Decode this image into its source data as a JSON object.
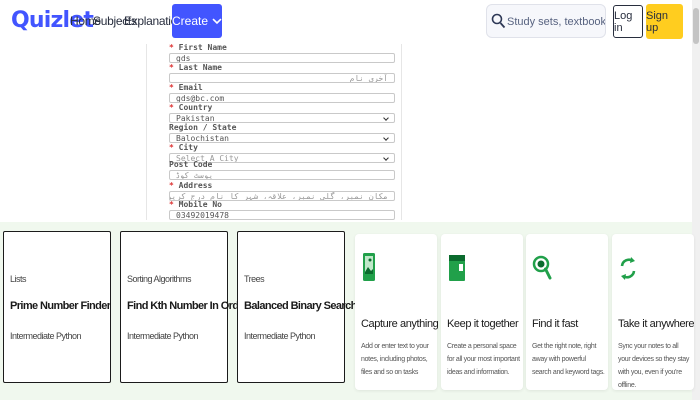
{
  "header": {
    "logo": "Quizlet",
    "nav": [
      "Home",
      "Subjects",
      "Explanations"
    ],
    "create_label": "Create",
    "search_placeholder": "Study sets, textbooks, ...",
    "login_label": "Log in",
    "signup_label": "Sign up"
  },
  "form": {
    "fields": [
      {
        "label": "First Name",
        "required": true,
        "value": "gds",
        "kind": "text"
      },
      {
        "label": "Last Name",
        "required": true,
        "value": "آخری نام",
        "kind": "rtl-placeholder"
      },
      {
        "label": "Email",
        "required": true,
        "value": "gds@bc.com",
        "kind": "text"
      },
      {
        "label": "Country",
        "required": true,
        "value": "Pakistan",
        "kind": "select"
      },
      {
        "label": "Region / State",
        "required": false,
        "value": "Balochistan",
        "kind": "select"
      },
      {
        "label": "City",
        "required": true,
        "value": "Select A City",
        "kind": "select-placeholder"
      },
      {
        "label": "Post Code",
        "required": false,
        "value": "پوسٹ کوڈ",
        "kind": "rtl-placeholder"
      },
      {
        "label": "Address",
        "required": true,
        "value": "مکان نمبر، گلی نمبر، علاقہ، شہر کا نام درج کریں",
        "kind": "rtl-placeholder"
      },
      {
        "label": "Mobile No",
        "required": true,
        "value": "03492019478",
        "kind": "text"
      }
    ]
  },
  "study_sets": [
    {
      "kind": "Lists",
      "title": "Prime Number Finder",
      "level": "Intermediate Python"
    },
    {
      "kind": "Sorting Algorithms",
      "title": "Find Kth Number In Order",
      "level": "Intermediate Python"
    },
    {
      "kind": "Trees",
      "title": "Balanced Binary Search Tree",
      "level": "Intermediate Python"
    }
  ],
  "features": [
    {
      "icon": "phone-image-icon",
      "title": "Capture anything",
      "desc": "Add or enter text to your notes, including photos, files and so on tasks"
    },
    {
      "icon": "notebook-icon",
      "title": "Keep it together",
      "desc": "Create a personal space for all your most important ideas and information."
    },
    {
      "icon": "magnifier-icon",
      "title": "Find it fast",
      "desc": "Get the right note, right away with powerful search and keyword tags."
    },
    {
      "icon": "sync-icon",
      "title": "Take it anywhere",
      "desc": "Sync your notes to all your devices so they stay with you, even if you're offline."
    }
  ],
  "colors": {
    "brand": "#4255ff",
    "signup": "#ffcd1f",
    "bottom_bg": "#f0f8ee",
    "feature_green": "#21a04a"
  }
}
